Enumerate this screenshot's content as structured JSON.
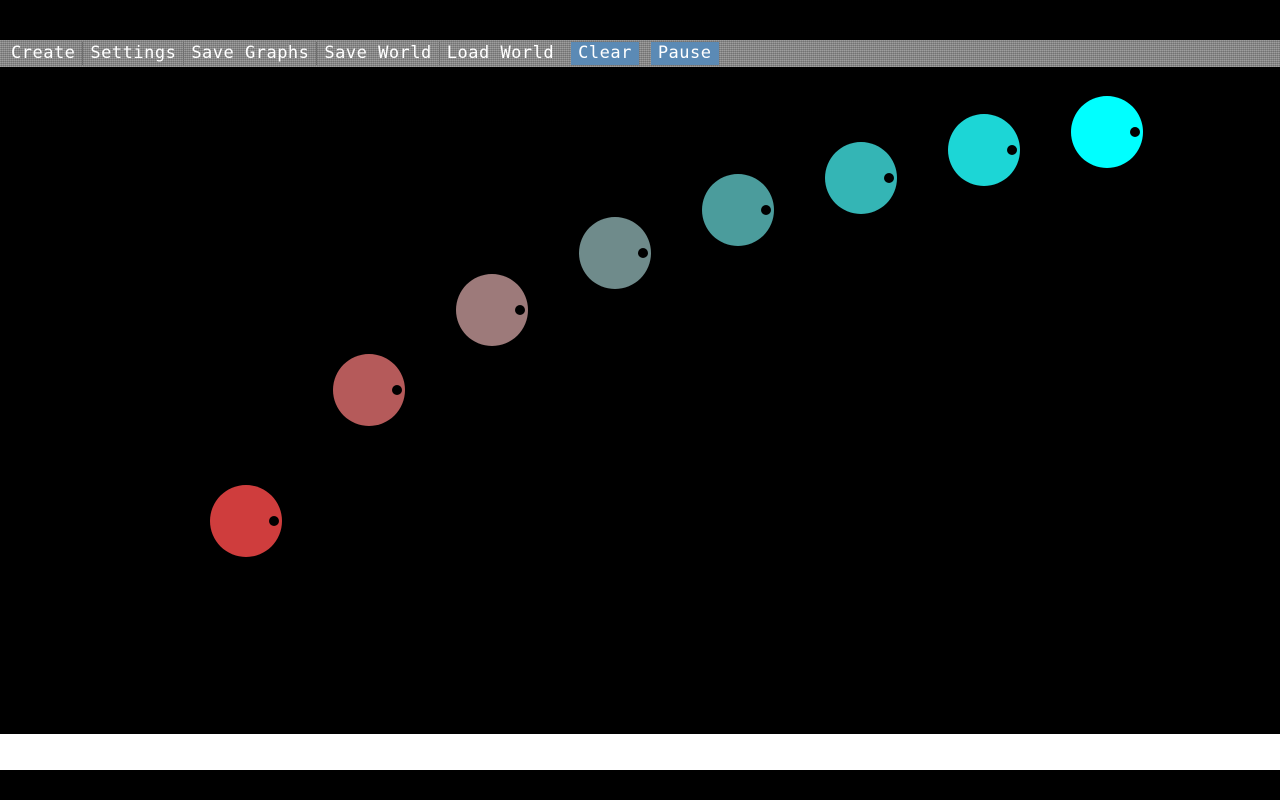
{
  "menu": {
    "items": [
      {
        "label": "Create",
        "active": false
      },
      {
        "label": "Settings",
        "active": false
      },
      {
        "label": "Save Graphs",
        "active": false
      },
      {
        "label": "Save World",
        "active": false
      },
      {
        "label": "Load World",
        "active": false
      },
      {
        "label": "Clear",
        "active": true
      },
      {
        "label": "Pause",
        "active": true
      }
    ]
  },
  "world": {
    "creatures": [
      {
        "color": "#cf3d3d"
      },
      {
        "color": "#b55a5a"
      },
      {
        "color": "#9d7a7a"
      },
      {
        "color": "#6f8b8b"
      },
      {
        "color": "#4b9c9c"
      },
      {
        "color": "#34b5b5"
      },
      {
        "color": "#1cd6d6"
      },
      {
        "color": "#00ffff"
      }
    ],
    "eye_color": "#000000",
    "background": "#000000"
  },
  "colors": {
    "menubar": "#8a8a8a",
    "active_button": "#5b8ab5",
    "menu_text": "#ffffff",
    "status_strip": "#ffffff"
  }
}
